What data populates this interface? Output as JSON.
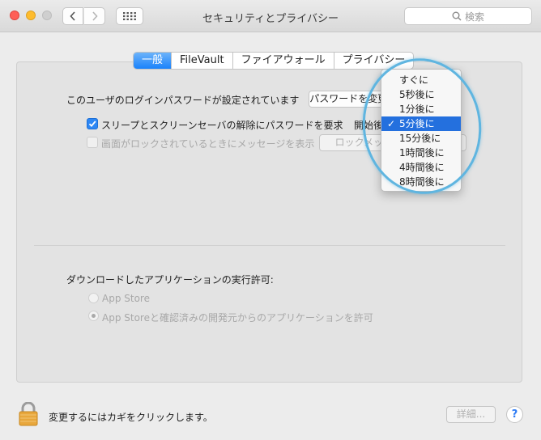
{
  "window": {
    "title": "セキュリティとプライバシー",
    "search_placeholder": "検索"
  },
  "tabs": [
    "一般",
    "FileVault",
    "ファイアウォール",
    "プライバシー"
  ],
  "general": {
    "login_password_text": "このユーザのログインパスワードが設定されています",
    "change_password_button": "パスワードを変更...",
    "require_password_label": "スリープとスクリーンセーバの解除にパスワードを要求",
    "require_password_checked": true,
    "after_label": "開始後",
    "show_message_label": "画面がロックされているときにメッセージを表示",
    "show_message_checked": false,
    "lock_message_button": "ロックメッセージを設定...",
    "download_heading": "ダウンロードしたアプリケーションの実行許可:",
    "radio_app_store": "App Store",
    "radio_app_store_dev": "App Storeと確認済みの開発元からのアプリケーションを許可",
    "radio_selected": "App Storeと確認済みの開発元からのアプリケーションを許可"
  },
  "delay_menu": {
    "options": [
      "すぐに",
      "5秒後に",
      "1分後に",
      "5分後に",
      "15分後に",
      "1時間後に",
      "4時間後に",
      "8時間後に"
    ],
    "selected": "5分後に"
  },
  "footer": {
    "lock_text": "変更するにはカギをクリックします。",
    "advanced_button": "詳細...",
    "help_label": "?"
  },
  "colors": {
    "accent": "#1a82fb",
    "highlight_circle": "#5fb5e0",
    "menu_selection": "#2470de"
  }
}
